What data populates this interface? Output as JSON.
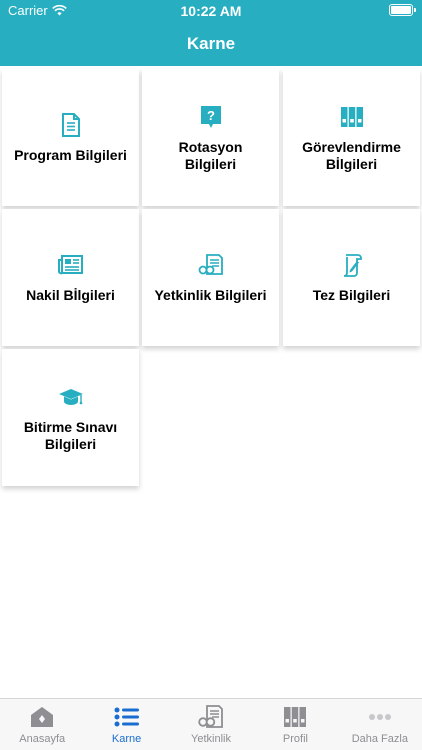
{
  "status": {
    "carrier": "Carrier",
    "time": "10:22 AM"
  },
  "header": {
    "title": "Karne"
  },
  "tiles": [
    {
      "label": "Program Bilgileri",
      "icon": "document-icon"
    },
    {
      "label": "Rotasyon Bilgileri",
      "icon": "question-icon"
    },
    {
      "label": "Görevlendirme Bİlgileri",
      "icon": "binders-icon"
    },
    {
      "label": "Nakil Bİlgileri",
      "icon": "newspaper-icon"
    },
    {
      "label": "Yetkinlik Bilgileri",
      "icon": "glasses-document-icon"
    },
    {
      "label": "Tez Bilgileri",
      "icon": "pen-paper-icon"
    },
    {
      "label": "Bitirme Sınavı Bilgileri",
      "icon": "graduation-cap-icon"
    }
  ],
  "tabs": [
    {
      "label": "Anasayfa",
      "icon": "home-icon",
      "active": false
    },
    {
      "label": "Karne",
      "icon": "list-icon",
      "active": true
    },
    {
      "label": "Yetkinlik",
      "icon": "glasses-document-icon",
      "active": false
    },
    {
      "label": "Profil",
      "icon": "binders-icon",
      "active": false
    },
    {
      "label": "Daha Fazla",
      "icon": "more-icon",
      "active": false
    }
  ],
  "colors": {
    "accent": "#27aec0",
    "active_tab": "#1a6dd0",
    "inactive_tab": "#8e8e93"
  }
}
